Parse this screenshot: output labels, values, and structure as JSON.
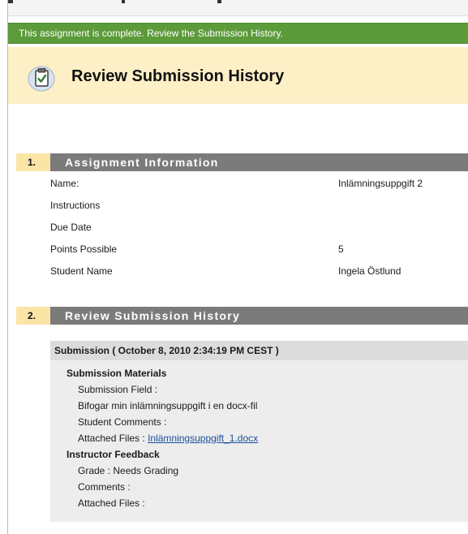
{
  "receipt": {
    "message": "This assignment is complete. Review the Submission History."
  },
  "page": {
    "title": "Review Submission History",
    "icon": "clipboard-check-icon"
  },
  "steps": [
    {
      "number": "1.",
      "title": "Assignment Information"
    },
    {
      "number": "2.",
      "title": "Review Submission History"
    }
  ],
  "assignment_info": {
    "rows": [
      {
        "label": "Name:",
        "value": "Inlämningsuppgift 2"
      },
      {
        "label": "Instructions",
        "value": ""
      },
      {
        "label": "Due Date",
        "value": ""
      },
      {
        "label": "Points Possible",
        "value": "5"
      },
      {
        "label": "Student Name",
        "value": "Ingela Östlund"
      }
    ]
  },
  "submission": {
    "header": "Submission ( October 8, 2010 2:34:19 PM CEST )",
    "materials_heading": "Submission Materials",
    "field_label": "Submission Field :",
    "field_text": "Bifogar min inlämningsuppgift i en docx-fil",
    "student_comments_label": "Student Comments :",
    "attached_files_label": "Attached Files :",
    "attached_file_name": "Inlämningsuppgift_1.docx",
    "feedback_heading": "Instructor Feedback",
    "grade_text": "Grade : Needs Grading",
    "comments_label": "Comments :",
    "feedback_files_label": "Attached Files :"
  },
  "colors": {
    "success_bar": "#5c9b3a",
    "header_bg": "#fdefc6",
    "step_bar": "#7b7b7b",
    "link": "#1a4f9c"
  }
}
